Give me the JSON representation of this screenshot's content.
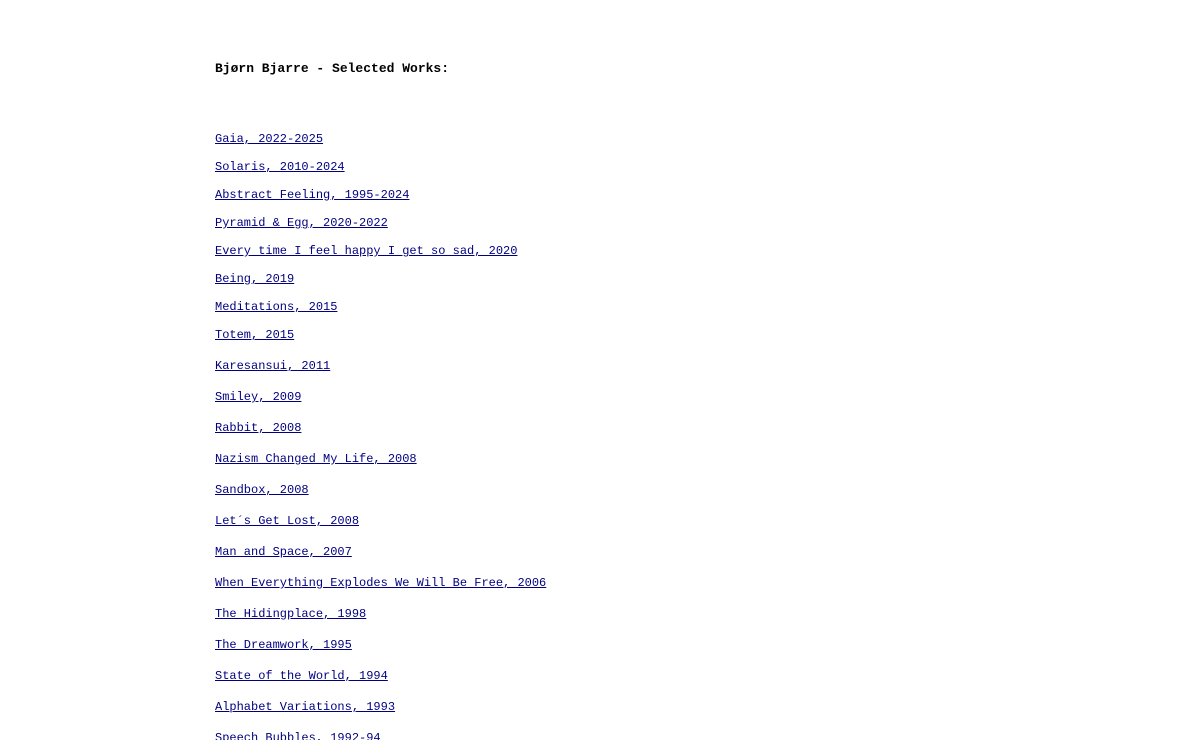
{
  "header": {
    "title": "Bjørn Bjarre - Selected Works:"
  },
  "works": [
    "Gaia, 2022-2025",
    "Solaris, 2010-2024",
    "Abstract Feeling, 1995-2024",
    "Pyramid & Egg, 2020-2022",
    "Every time I feel happy I get so sad, 2020",
    "Being, 2019",
    "Meditations, 2015",
    "Totem, 2015",
    "Karesansui, 2011",
    "Smiley, 2009",
    "Rabbit, 2008",
    "Nazism Changed My Life, 2008",
    "Sandbox, 2008",
    "Let´s Get Lost, 2008",
    "Man and Space, 2007",
    "When Everything Explodes We Will Be Free, 2006",
    "The Hidingplace, 1998",
    "The Dreamwork, 1995",
    "State of the World, 1994",
    "Alphabet Variations, 1993",
    "Speech Bubbles, 1992-94"
  ],
  "colors": {
    "link": "#000080",
    "text": "#000000",
    "background": "#ffffff"
  }
}
